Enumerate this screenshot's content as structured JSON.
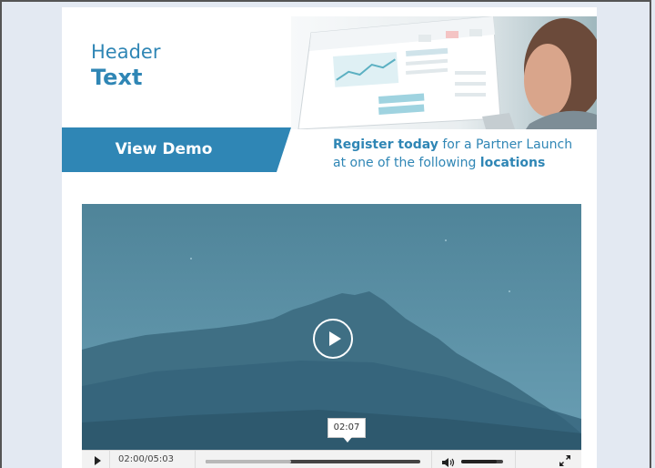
{
  "header": {
    "line1": "Header",
    "line2": "Text"
  },
  "demo_button": {
    "label": "View Demo"
  },
  "register": {
    "bold_lead": "Register today",
    "middle": " for a Partner Launch at one of the following ",
    "bold_tail": "locations"
  },
  "video": {
    "tooltip_time": "02:07",
    "time_display": "02:00/05:03",
    "progress_fraction": 0.4,
    "volume_fraction": 0.85
  },
  "colors": {
    "accent": "#2f86b5",
    "page_background": "#e3e9f2",
    "video_tint": "#5a8fa8"
  },
  "icons": [
    "play-icon",
    "volume-icon",
    "fullscreen-icon"
  ]
}
